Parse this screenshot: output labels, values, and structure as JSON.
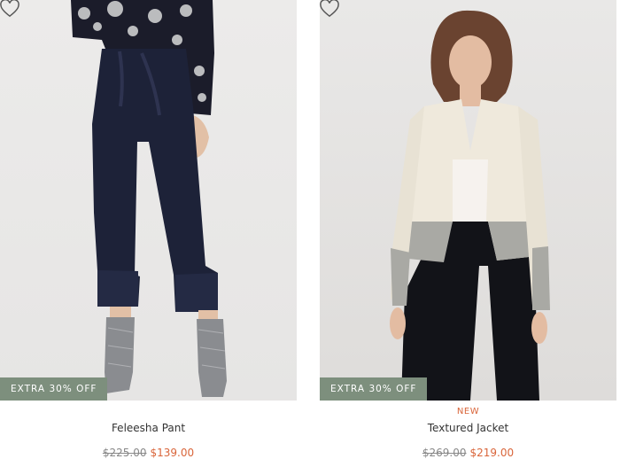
{
  "products": [
    {
      "name": "Feleesha Pant",
      "badge": "EXTRA 30% OFF",
      "new_label": "",
      "original_price": "$225.00",
      "sale_price": "$139.00"
    },
    {
      "name": "Textured Jacket",
      "badge": "EXTRA 30% OFF",
      "new_label": "NEW",
      "original_price": "$269.00",
      "sale_price": "$219.00"
    }
  ],
  "colors": {
    "badge_bg": "#7d8f7d",
    "sale_price": "#d9653a",
    "new_label": "#d9653a"
  },
  "icons": [
    "heart-icon"
  ]
}
